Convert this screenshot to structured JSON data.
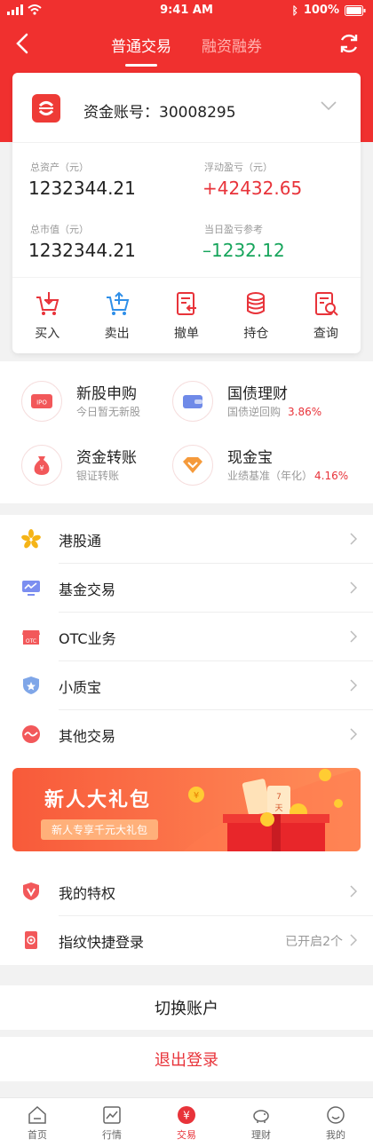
{
  "status_bar": {
    "time": "9:41 AM",
    "battery": "100%"
  },
  "nav": {
    "tab_normal": "普通交易",
    "tab_margin": "融资融券"
  },
  "account": {
    "label": "资金账号：30008295"
  },
  "stats": {
    "total_assets_label": "总资产（元）",
    "total_assets": "1232344.21",
    "float_pl_label": "浮动盈亏（元）",
    "float_pl": "+42432.65",
    "market_value_label": "总市值（元）",
    "market_value": "1232344.21",
    "today_pl_label": "当日盈亏参考",
    "today_pl": "–1232.12"
  },
  "actions": [
    "买入",
    "卖出",
    "撤单",
    "持仓",
    "查询"
  ],
  "grid": [
    {
      "title": "新股申购",
      "sub": "今日暂无新股",
      "rate": ""
    },
    {
      "title": "国债理财",
      "sub": "国债逆回购",
      "rate": "3.86%"
    },
    {
      "title": "资金转账",
      "sub": "银证转账",
      "rate": ""
    },
    {
      "title": "现金宝",
      "sub": "业绩基准（年化）",
      "rate": "4.16%"
    }
  ],
  "list": [
    "港股通",
    "基金交易",
    "OTC业务",
    "小质宝",
    "其他交易"
  ],
  "banner": {
    "title": "新人大礼包",
    "subtitle": "新人专享千元大礼包"
  },
  "list2": {
    "privilege": "我的特权",
    "fingerprint": "指纹快捷登录",
    "fingerprint_status": "已开启2个"
  },
  "buttons": {
    "switch": "切换账户",
    "logout": "退出登录"
  },
  "tabbar": [
    "首页",
    "行情",
    "交易",
    "理财",
    "我的"
  ],
  "colors": {
    "brand_red": "#f0302f",
    "profit_red": "#e8333a",
    "loss_green": "#17a55c"
  }
}
